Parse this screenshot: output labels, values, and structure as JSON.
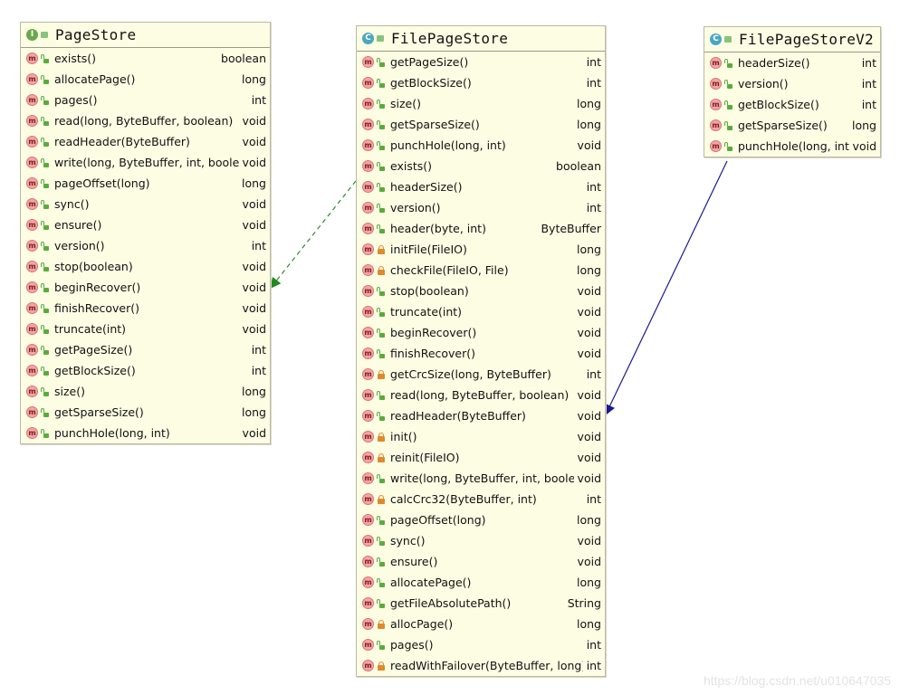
{
  "classes": {
    "pagestore": {
      "kind": "I",
      "name": "PageStore",
      "members": [
        {
          "sig": "exists()",
          "type": "boolean",
          "vis": "public"
        },
        {
          "sig": "allocatePage()",
          "type": "long",
          "vis": "public"
        },
        {
          "sig": "pages()",
          "type": "int",
          "vis": "public"
        },
        {
          "sig": "read(long, ByteBuffer, boolean)",
          "type": "void",
          "vis": "public"
        },
        {
          "sig": "readHeader(ByteBuffer)",
          "type": "void",
          "vis": "public"
        },
        {
          "sig": "write(long, ByteBuffer, int, boolean)",
          "type": "void",
          "vis": "public"
        },
        {
          "sig": "pageOffset(long)",
          "type": "long",
          "vis": "public"
        },
        {
          "sig": "sync()",
          "type": "void",
          "vis": "public"
        },
        {
          "sig": "ensure()",
          "type": "void",
          "vis": "public"
        },
        {
          "sig": "version()",
          "type": "int",
          "vis": "public"
        },
        {
          "sig": "stop(boolean)",
          "type": "void",
          "vis": "public"
        },
        {
          "sig": "beginRecover()",
          "type": "void",
          "vis": "public"
        },
        {
          "sig": "finishRecover()",
          "type": "void",
          "vis": "public"
        },
        {
          "sig": "truncate(int)",
          "type": "void",
          "vis": "public"
        },
        {
          "sig": "getPageSize()",
          "type": "int",
          "vis": "public"
        },
        {
          "sig": "getBlockSize()",
          "type": "int",
          "vis": "public"
        },
        {
          "sig": "size()",
          "type": "long",
          "vis": "public"
        },
        {
          "sig": "getSparseSize()",
          "type": "long",
          "vis": "public"
        },
        {
          "sig": "punchHole(long, int)",
          "type": "void",
          "vis": "public"
        }
      ]
    },
    "filepagestore": {
      "kind": "C",
      "name": "FilePageStore",
      "members": [
        {
          "sig": "getPageSize()",
          "type": "int",
          "vis": "public"
        },
        {
          "sig": "getBlockSize()",
          "type": "int",
          "vis": "public"
        },
        {
          "sig": "size()",
          "type": "long",
          "vis": "public"
        },
        {
          "sig": "getSparseSize()",
          "type": "long",
          "vis": "public"
        },
        {
          "sig": "punchHole(long, int)",
          "type": "void",
          "vis": "public"
        },
        {
          "sig": "exists()",
          "type": "boolean",
          "vis": "public"
        },
        {
          "sig": "headerSize()",
          "type": "int",
          "vis": "public"
        },
        {
          "sig": "version()",
          "type": "int",
          "vis": "public"
        },
        {
          "sig": "header(byte, int)",
          "type": "ByteBuffer",
          "vis": "public"
        },
        {
          "sig": "initFile(FileIO)",
          "type": "long",
          "vis": "private"
        },
        {
          "sig": "checkFile(FileIO, File)",
          "type": "long",
          "vis": "private"
        },
        {
          "sig": "stop(boolean)",
          "type": "void",
          "vis": "public"
        },
        {
          "sig": "truncate(int)",
          "type": "void",
          "vis": "public"
        },
        {
          "sig": "beginRecover()",
          "type": "void",
          "vis": "public"
        },
        {
          "sig": "finishRecover()",
          "type": "void",
          "vis": "public"
        },
        {
          "sig": "getCrcSize(long, ByteBuffer)",
          "type": "int",
          "vis": "private"
        },
        {
          "sig": "read(long, ByteBuffer, boolean)",
          "type": "void",
          "vis": "public"
        },
        {
          "sig": "readHeader(ByteBuffer)",
          "type": "void",
          "vis": "public"
        },
        {
          "sig": "init()",
          "type": "void",
          "vis": "private"
        },
        {
          "sig": "reinit(FileIO)",
          "type": "void",
          "vis": "private"
        },
        {
          "sig": "write(long, ByteBuffer, int, boolean)",
          "type": "void",
          "vis": "public"
        },
        {
          "sig": "calcCrc32(ByteBuffer, int)",
          "type": "int",
          "vis": "private"
        },
        {
          "sig": "pageOffset(long)",
          "type": "long",
          "vis": "public"
        },
        {
          "sig": "sync()",
          "type": "void",
          "vis": "public"
        },
        {
          "sig": "ensure()",
          "type": "void",
          "vis": "public"
        },
        {
          "sig": "allocatePage()",
          "type": "long",
          "vis": "public"
        },
        {
          "sig": "getFileAbsolutePath()",
          "type": "String",
          "vis": "public"
        },
        {
          "sig": "allocPage()",
          "type": "long",
          "vis": "private"
        },
        {
          "sig": "pages()",
          "type": "int",
          "vis": "public"
        },
        {
          "sig": "readWithFailover(ByteBuffer, long)",
          "type": "int",
          "vis": "private"
        }
      ]
    },
    "filepagestorev2": {
      "kind": "C",
      "name": "FilePageStoreV2",
      "members": [
        {
          "sig": "headerSize()",
          "type": "int",
          "vis": "public"
        },
        {
          "sig": "version()",
          "type": "int",
          "vis": "public"
        },
        {
          "sig": "getBlockSize()",
          "type": "int",
          "vis": "public"
        },
        {
          "sig": "getSparseSize()",
          "type": "long",
          "vis": "public"
        },
        {
          "sig": "punchHole(long, int)",
          "type": "void",
          "vis": "public"
        }
      ]
    }
  },
  "member_badge": "m",
  "edges": [
    {
      "from": "FilePageStore",
      "to": "PageStore",
      "kind": "implements",
      "color": "#2e8b2e"
    },
    {
      "from": "FilePageStoreV2",
      "to": "FilePageStore",
      "kind": "extends",
      "color": "#1a1a8c"
    }
  ],
  "watermark": "https://blog.csdn.net/u010647035"
}
